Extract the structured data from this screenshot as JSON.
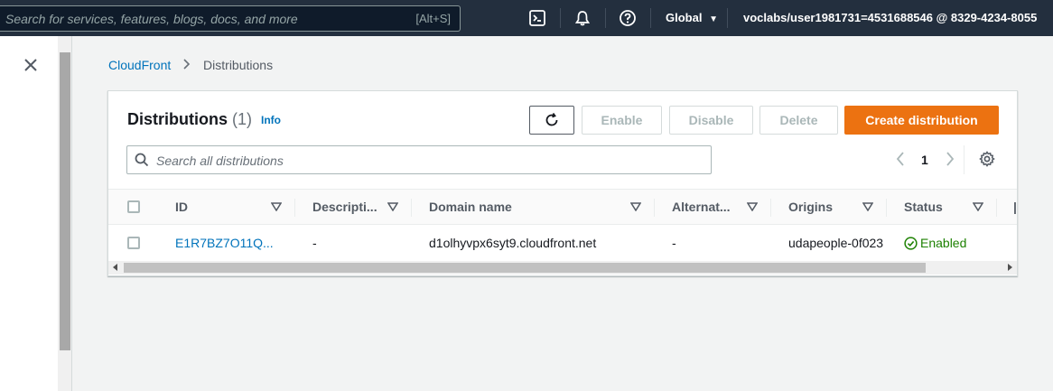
{
  "topnav": {
    "search_placeholder": "Search for services, features, blogs, docs, and more",
    "search_shortcut": "[Alt+S]",
    "region": "Global",
    "account": "voclabs/user1981731=4531688546 @ 8329-4234-8055"
  },
  "breadcrumb": {
    "parent": "CloudFront",
    "current": "Distributions"
  },
  "card": {
    "title": "Distributions",
    "count": "(1)",
    "info": "Info",
    "buttons": {
      "enable": "Enable",
      "disable": "Disable",
      "delete": "Delete",
      "create": "Create distribution"
    },
    "search_placeholder": "Search all distributions",
    "page": "1"
  },
  "table": {
    "headers": [
      "ID",
      "Descripti...",
      "Domain name",
      "Alternat...",
      "Origins",
      "Status"
    ],
    "rows": [
      {
        "id": "E1R7BZ7O11Q...",
        "description": "-",
        "domain": "d1olhyvpx6syt9.cloudfront.net",
        "alternate": "-",
        "origins": "udapeople-0f023",
        "status": "Enabled"
      }
    ]
  },
  "colors": {
    "nav_bg": "#232f3e",
    "primary": "#ec7211",
    "link": "#0073bb",
    "success": "#1d8102"
  }
}
